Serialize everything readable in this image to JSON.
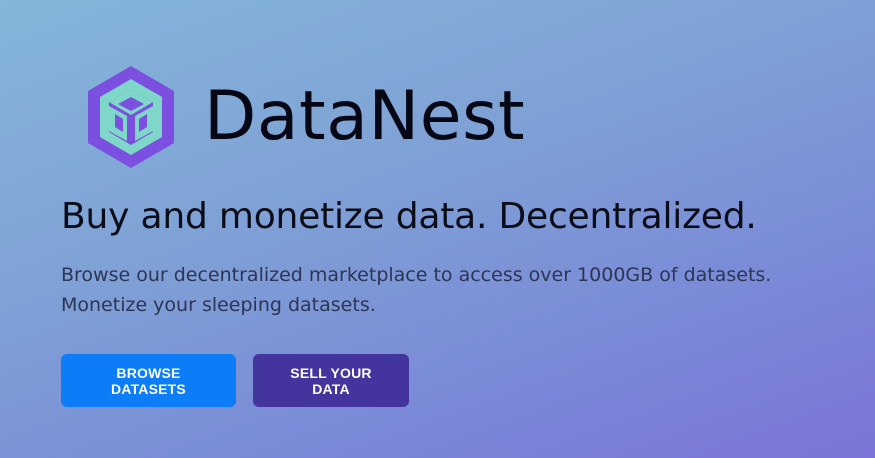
{
  "colors": {
    "primary_button_bg": "#0d7cf7",
    "secondary_button_bg": "#44349d",
    "logo_outer": "#7b4fe0",
    "logo_inner": "#7fd7c9",
    "brand_text": "#050714"
  },
  "logo": {
    "icon": "cube-logo-icon"
  },
  "brand": {
    "name": "DataNest"
  },
  "hero": {
    "headline": "Buy and monetize data. Decentralized.",
    "subtext_line1": "Browse our decentralized marketplace to access over 1000GB of datasets.",
    "subtext_line2": "Monetize your sleeping datasets."
  },
  "actions": {
    "browse_label": "BROWSE DATASETS",
    "sell_label": "SELL YOUR DATA"
  }
}
